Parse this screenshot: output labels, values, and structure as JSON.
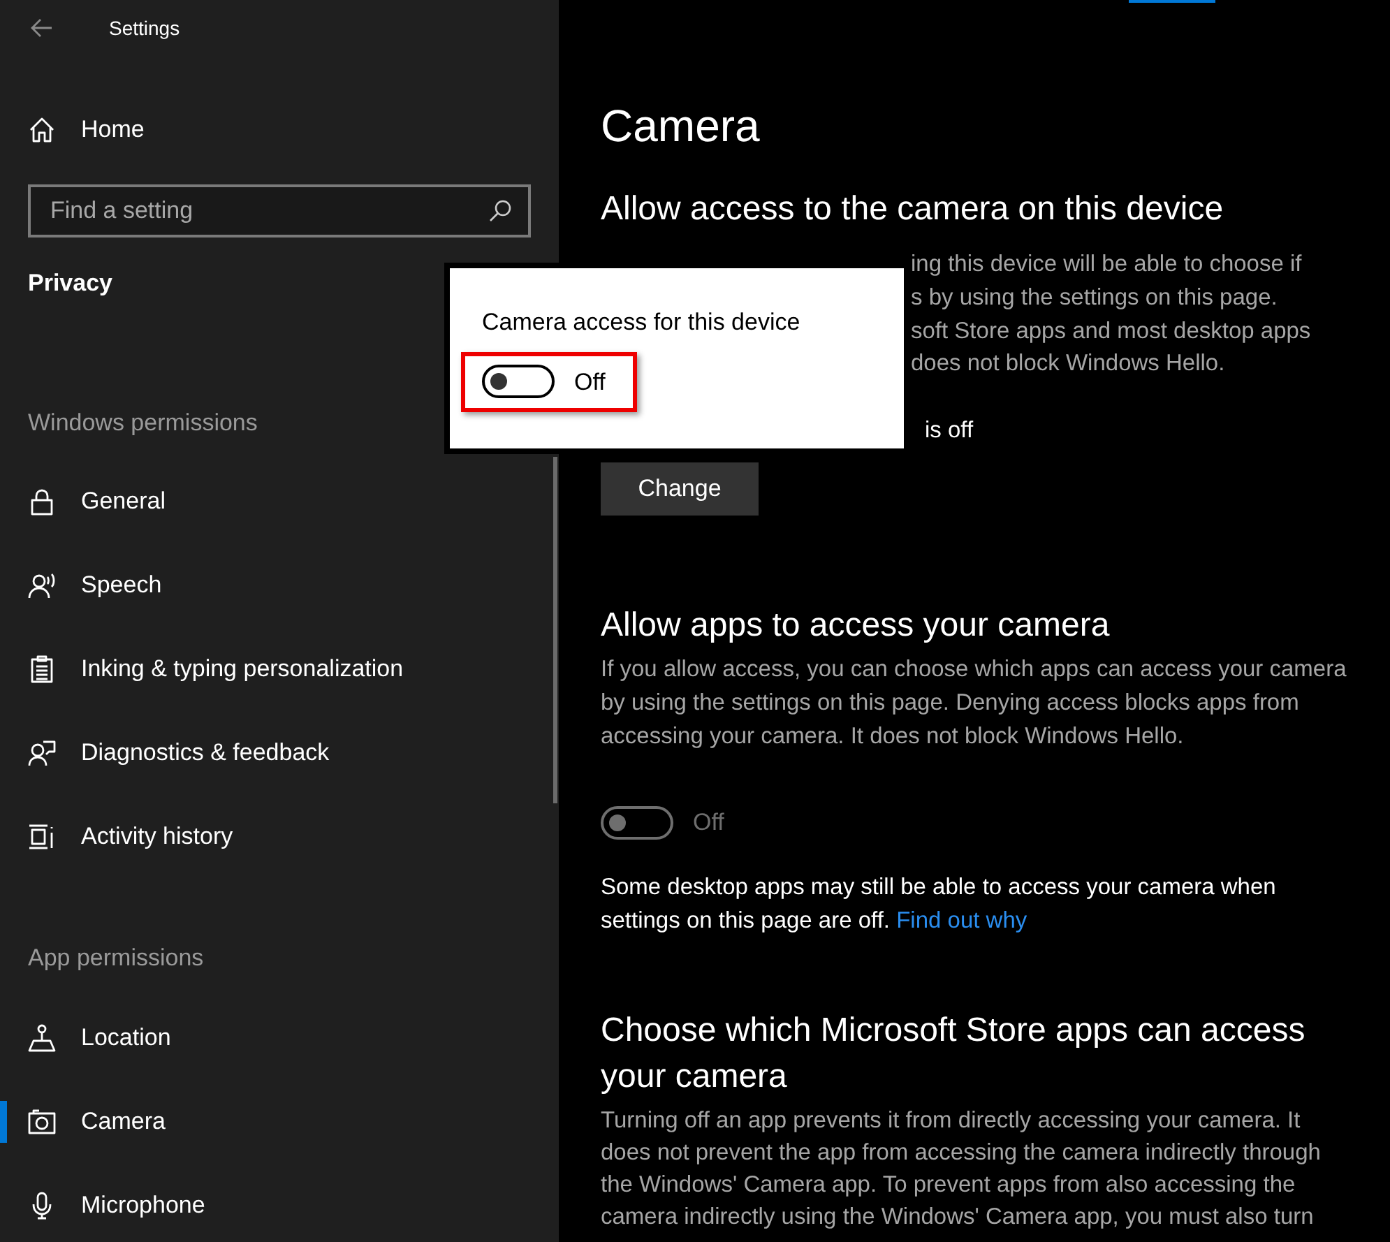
{
  "window": {
    "title": "Settings"
  },
  "sidebar": {
    "home": "Home",
    "search": {
      "placeholder": "Find a setting"
    },
    "section_title": "Privacy",
    "groups": [
      {
        "heading": "Windows permissions",
        "items": [
          {
            "label": "General",
            "selected": false
          },
          {
            "label": "Speech",
            "selected": false
          },
          {
            "label": "Inking & typing personalization",
            "selected": false
          },
          {
            "label": "Diagnostics & feedback",
            "selected": false
          },
          {
            "label": "Activity history",
            "selected": false
          }
        ]
      },
      {
        "heading": "App permissions",
        "items": [
          {
            "label": "Location",
            "selected": false
          },
          {
            "label": "Camera",
            "selected": true
          },
          {
            "label": "Microphone",
            "selected": false
          }
        ]
      }
    ]
  },
  "main": {
    "title": "Camera",
    "device_section": {
      "heading": "Allow access to the camera on this device",
      "description_visible": [
        "ing this device will be able to choose if",
        "s by using the settings on this page.",
        "soft Store apps and most desktop apps",
        "does not block Windows Hello."
      ],
      "status_visible": "is off",
      "button": "Change"
    },
    "apps_section": {
      "heading": "Allow apps to access your camera",
      "description": "If you allow access, you can choose which apps can access your camera by using the settings on this page. Denying access blocks apps from accessing your camera. It does not block Windows Hello.",
      "toggle": {
        "on": false,
        "disabled": true,
        "label": "Off"
      },
      "note": "Some desktop apps may still be able to access your camera when settings on this page are off.",
      "note_link": "Find out why"
    },
    "store_section": {
      "heading": "Choose which Microsoft Store apps can access your camera",
      "description": "Turning off an app prevents it from directly accessing your camera. It does not prevent the app from accessing the camera indirectly through the Windows' Camera app. To prevent apps from also accessing the camera indirectly using the Windows' Camera app, you must also turn"
    }
  },
  "popup": {
    "label": "Camera access for this device",
    "toggle": {
      "on": false,
      "disabled": false,
      "label": "Off"
    },
    "highlighted": true
  }
}
